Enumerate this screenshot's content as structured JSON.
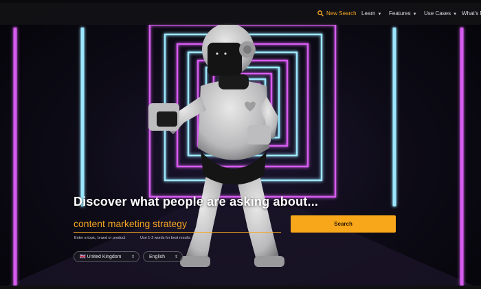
{
  "nav": {
    "new_search": "New Search",
    "learn": "Learn",
    "features": "Features",
    "use_cases": "Use Cases",
    "whats_new": "What's N"
  },
  "hero": {
    "headline": "Discover what people are asking about..."
  },
  "search": {
    "value": "content marketing strategy",
    "button_label": "Search",
    "hint_topic": "Enter a topic, brand or product",
    "hint_words": "Use 1-2 words for best results"
  },
  "filters": {
    "region_flag": "🇬🇧",
    "region": "United Kingdom",
    "language": "English"
  },
  "colors": {
    "accent": "#f5a623",
    "neon_pink": "#d050e8",
    "neon_cyan": "#8fe0ff"
  },
  "icons": {
    "search": "magnifier-icon",
    "caret": "chevron-down-icon"
  }
}
